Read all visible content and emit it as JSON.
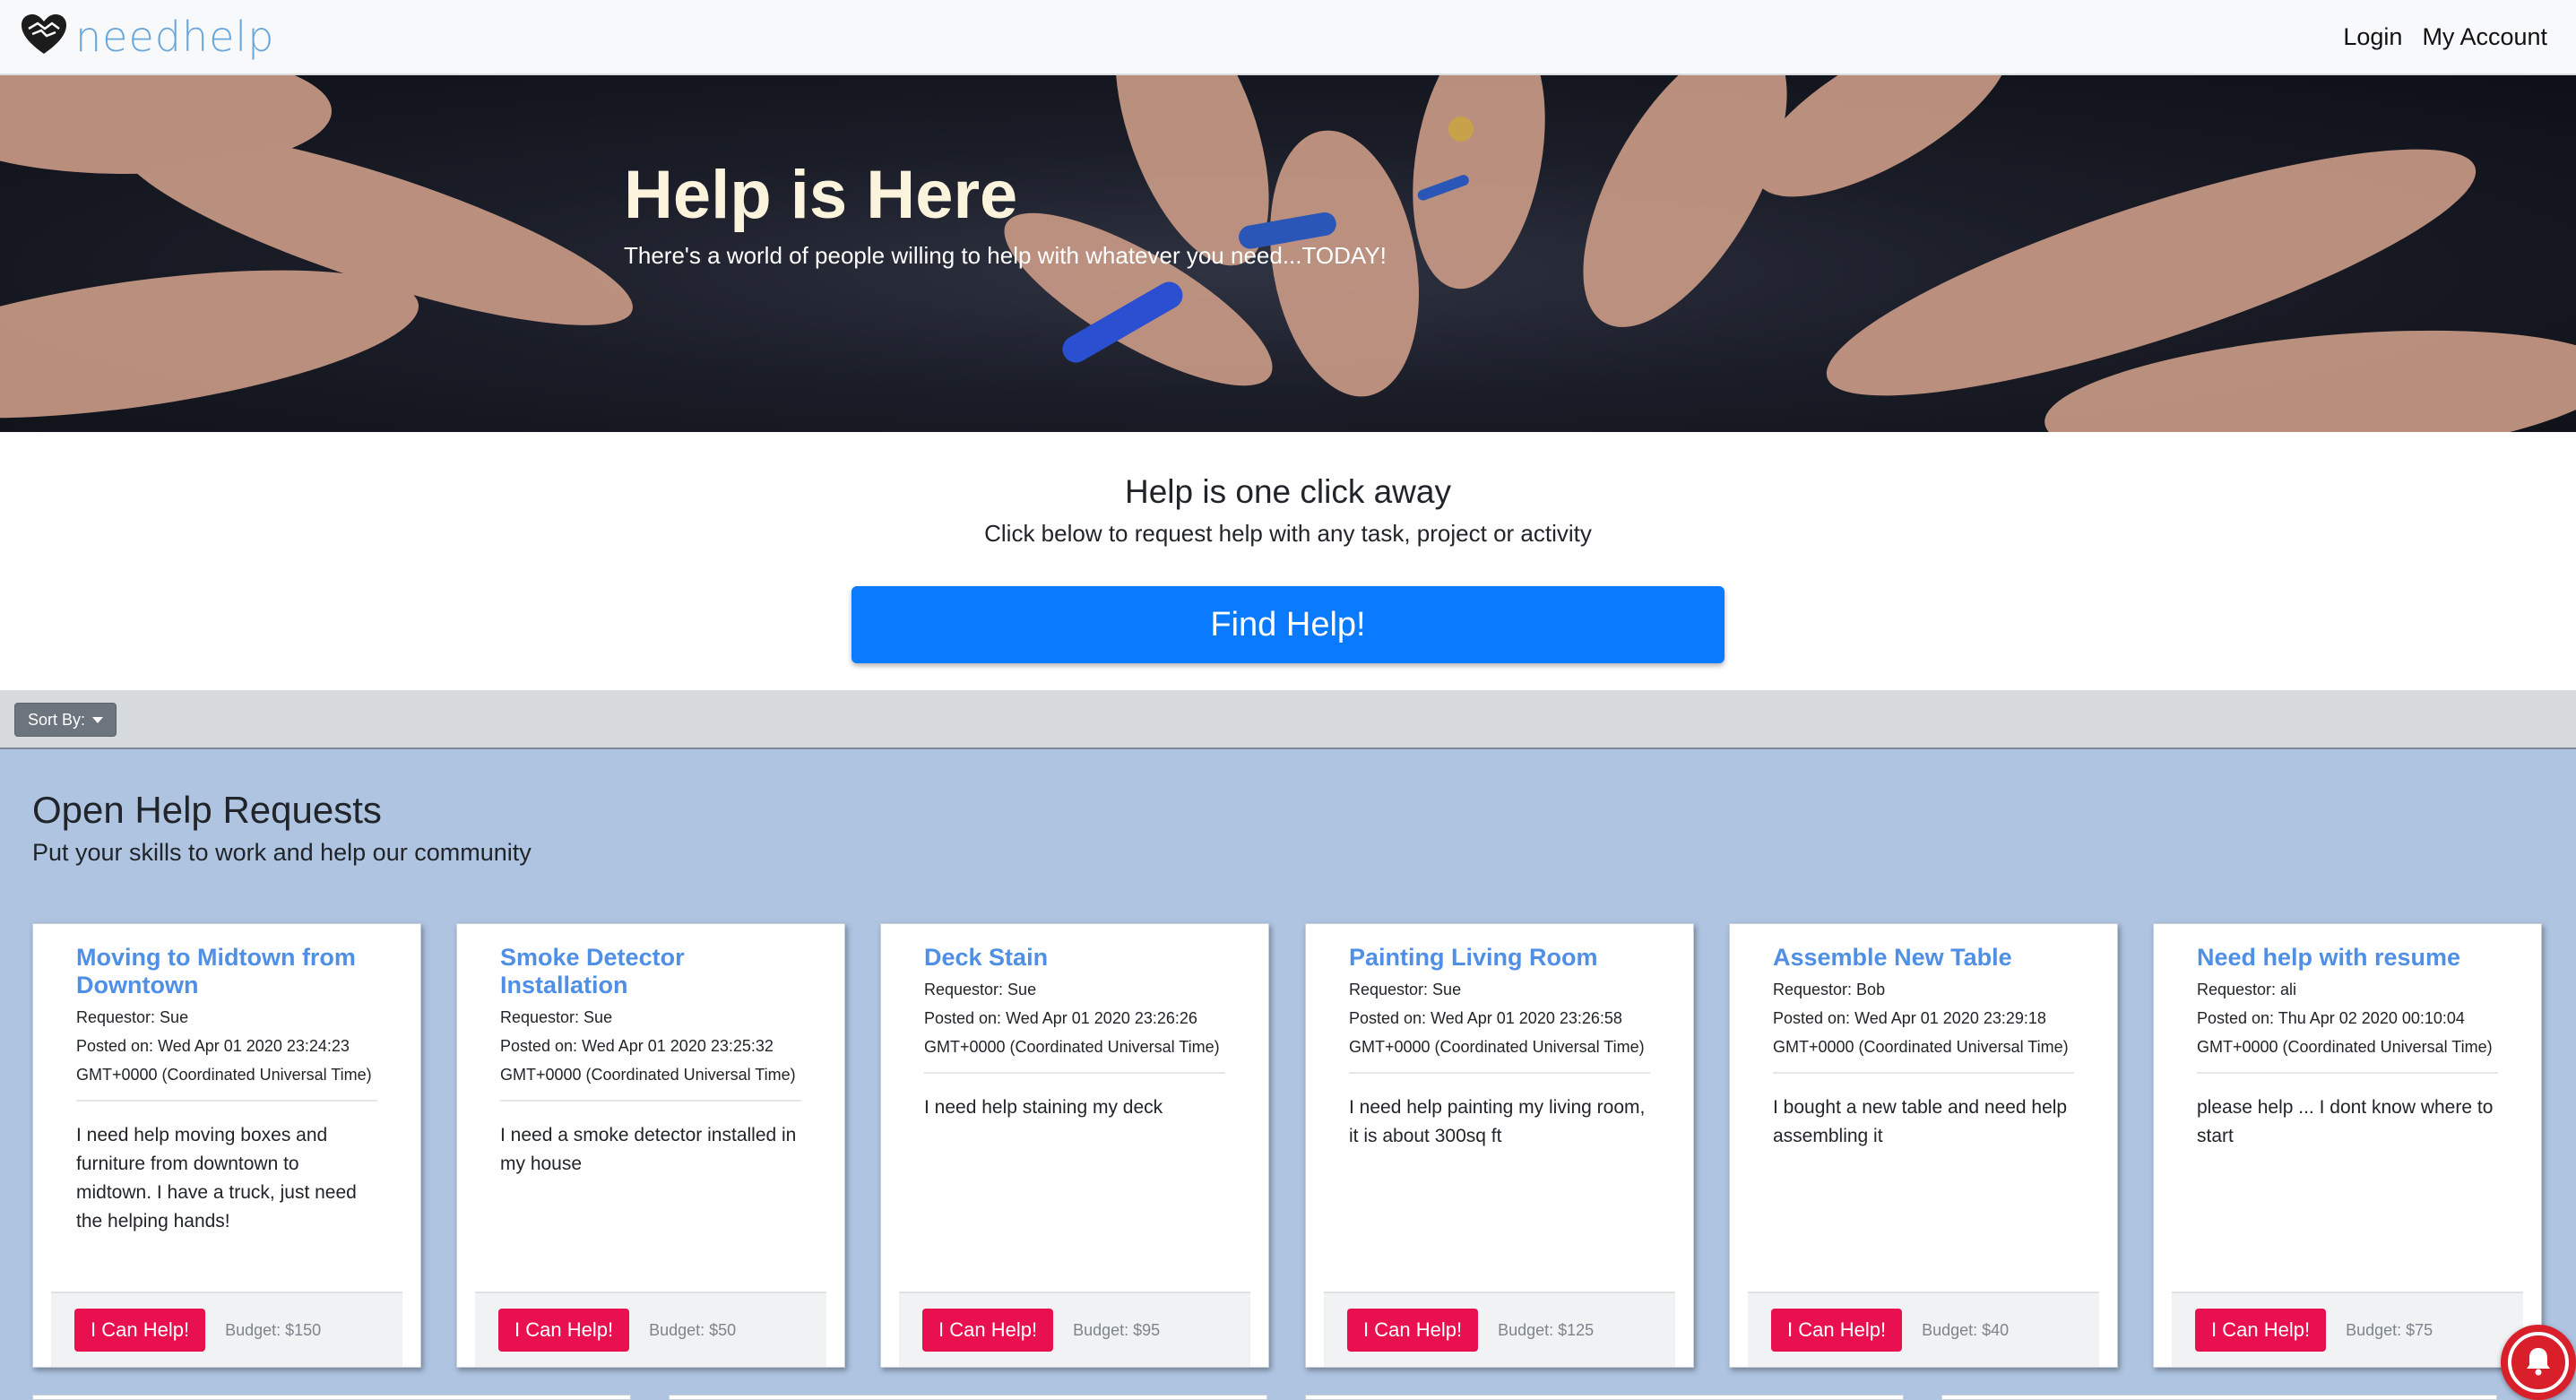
{
  "navbar": {
    "brand": "needhelp",
    "links": [
      "Login",
      "My Account"
    ]
  },
  "hero": {
    "title": "Help is Here",
    "subtitle": "There's a world of people willing to help with whatever you need...TODAY!"
  },
  "cta": {
    "title": "Help is one click away",
    "subtitle": "Click below to request help with any task, project or activity",
    "button": "Find Help!"
  },
  "sort": {
    "label": "Sort By:"
  },
  "requests": {
    "title": "Open Help Requests",
    "subtitle": "Put your skills to work and help our community",
    "cards": [
      {
        "title": "Moving to Midtown from Downtown",
        "requestor": "Requestor: Sue",
        "posted": "Posted on: Wed Apr 01 2020 23:24:23 GMT+0000 (Coordinated Universal Time)",
        "description": "I need help moving boxes and furniture from downtown to midtown. I have a truck, just need the helping hands!",
        "button": "I Can Help!",
        "budget": "Budget: $150"
      },
      {
        "title": "Smoke Detector Installation",
        "requestor": "Requestor: Sue",
        "posted": "Posted on: Wed Apr 01 2020 23:25:32 GMT+0000 (Coordinated Universal Time)",
        "description": "I need a smoke detector installed in my house",
        "button": "I Can Help!",
        "budget": "Budget: $50"
      },
      {
        "title": "Deck Stain",
        "requestor": "Requestor: Sue",
        "posted": "Posted on: Wed Apr 01 2020 23:26:26 GMT+0000 (Coordinated Universal Time)",
        "description": "I need help staining my deck",
        "button": "I Can Help!",
        "budget": "Budget: $95"
      },
      {
        "title": "Painting Living Room",
        "requestor": "Requestor: Sue",
        "posted": "Posted on: Wed Apr 01 2020 23:26:58 GMT+0000 (Coordinated Universal Time)",
        "description": "I need help painting my living room, it is about 300sq ft",
        "button": "I Can Help!",
        "budget": "Budget: $125"
      },
      {
        "title": "Assemble New Table",
        "requestor": "Requestor: Bob",
        "posted": "Posted on: Wed Apr 01 2020 23:29:18 GMT+0000 (Coordinated Universal Time)",
        "description": "I bought a new table and need help assembling it",
        "button": "I Can Help!",
        "budget": "Budget: $40"
      },
      {
        "title": "Need help with resume",
        "requestor": "Requestor: ali",
        "posted": "Posted on: Thu Apr 02 2020 00:10:04 GMT+0000 (Coordinated Universal Time)",
        "description": "please help ... I dont know where to start",
        "button": "I Can Help!",
        "budget": "Budget: $75"
      }
    ]
  },
  "icons": {
    "logo": "heart-hands-icon",
    "sort_caret": "caret-down-icon",
    "notification": "bell-icon"
  },
  "colors": {
    "brand": "#6aa7dd",
    "primary_button": "#0a7bff",
    "help_button": "#e8104f",
    "card_title": "#4f8fe6",
    "section_bg": "#aec4e1",
    "notification": "#d81f2a"
  }
}
